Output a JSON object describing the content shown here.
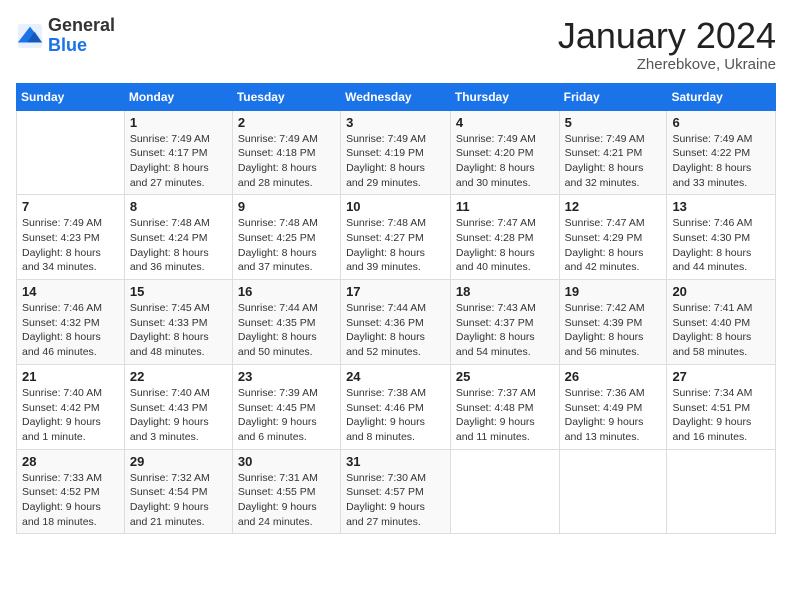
{
  "logo": {
    "general": "General",
    "blue": "Blue"
  },
  "title": "January 2024",
  "location": "Zherebkove, Ukraine",
  "days_of_week": [
    "Sunday",
    "Monday",
    "Tuesday",
    "Wednesday",
    "Thursday",
    "Friday",
    "Saturday"
  ],
  "weeks": [
    [
      {
        "day": "",
        "info": ""
      },
      {
        "day": "1",
        "info": "Sunrise: 7:49 AM\nSunset: 4:17 PM\nDaylight: 8 hours\nand 27 minutes."
      },
      {
        "day": "2",
        "info": "Sunrise: 7:49 AM\nSunset: 4:18 PM\nDaylight: 8 hours\nand 28 minutes."
      },
      {
        "day": "3",
        "info": "Sunrise: 7:49 AM\nSunset: 4:19 PM\nDaylight: 8 hours\nand 29 minutes."
      },
      {
        "day": "4",
        "info": "Sunrise: 7:49 AM\nSunset: 4:20 PM\nDaylight: 8 hours\nand 30 minutes."
      },
      {
        "day": "5",
        "info": "Sunrise: 7:49 AM\nSunset: 4:21 PM\nDaylight: 8 hours\nand 32 minutes."
      },
      {
        "day": "6",
        "info": "Sunrise: 7:49 AM\nSunset: 4:22 PM\nDaylight: 8 hours\nand 33 minutes."
      }
    ],
    [
      {
        "day": "7",
        "info": "Sunrise: 7:49 AM\nSunset: 4:23 PM\nDaylight: 8 hours\nand 34 minutes."
      },
      {
        "day": "8",
        "info": "Sunrise: 7:48 AM\nSunset: 4:24 PM\nDaylight: 8 hours\nand 36 minutes."
      },
      {
        "day": "9",
        "info": "Sunrise: 7:48 AM\nSunset: 4:25 PM\nDaylight: 8 hours\nand 37 minutes."
      },
      {
        "day": "10",
        "info": "Sunrise: 7:48 AM\nSunset: 4:27 PM\nDaylight: 8 hours\nand 39 minutes."
      },
      {
        "day": "11",
        "info": "Sunrise: 7:47 AM\nSunset: 4:28 PM\nDaylight: 8 hours\nand 40 minutes."
      },
      {
        "day": "12",
        "info": "Sunrise: 7:47 AM\nSunset: 4:29 PM\nDaylight: 8 hours\nand 42 minutes."
      },
      {
        "day": "13",
        "info": "Sunrise: 7:46 AM\nSunset: 4:30 PM\nDaylight: 8 hours\nand 44 minutes."
      }
    ],
    [
      {
        "day": "14",
        "info": "Sunrise: 7:46 AM\nSunset: 4:32 PM\nDaylight: 8 hours\nand 46 minutes."
      },
      {
        "day": "15",
        "info": "Sunrise: 7:45 AM\nSunset: 4:33 PM\nDaylight: 8 hours\nand 48 minutes."
      },
      {
        "day": "16",
        "info": "Sunrise: 7:44 AM\nSunset: 4:35 PM\nDaylight: 8 hours\nand 50 minutes."
      },
      {
        "day": "17",
        "info": "Sunrise: 7:44 AM\nSunset: 4:36 PM\nDaylight: 8 hours\nand 52 minutes."
      },
      {
        "day": "18",
        "info": "Sunrise: 7:43 AM\nSunset: 4:37 PM\nDaylight: 8 hours\nand 54 minutes."
      },
      {
        "day": "19",
        "info": "Sunrise: 7:42 AM\nSunset: 4:39 PM\nDaylight: 8 hours\nand 56 minutes."
      },
      {
        "day": "20",
        "info": "Sunrise: 7:41 AM\nSunset: 4:40 PM\nDaylight: 8 hours\nand 58 minutes."
      }
    ],
    [
      {
        "day": "21",
        "info": "Sunrise: 7:40 AM\nSunset: 4:42 PM\nDaylight: 9 hours\nand 1 minute."
      },
      {
        "day": "22",
        "info": "Sunrise: 7:40 AM\nSunset: 4:43 PM\nDaylight: 9 hours\nand 3 minutes."
      },
      {
        "day": "23",
        "info": "Sunrise: 7:39 AM\nSunset: 4:45 PM\nDaylight: 9 hours\nand 6 minutes."
      },
      {
        "day": "24",
        "info": "Sunrise: 7:38 AM\nSunset: 4:46 PM\nDaylight: 9 hours\nand 8 minutes."
      },
      {
        "day": "25",
        "info": "Sunrise: 7:37 AM\nSunset: 4:48 PM\nDaylight: 9 hours\nand 11 minutes."
      },
      {
        "day": "26",
        "info": "Sunrise: 7:36 AM\nSunset: 4:49 PM\nDaylight: 9 hours\nand 13 minutes."
      },
      {
        "day": "27",
        "info": "Sunrise: 7:34 AM\nSunset: 4:51 PM\nDaylight: 9 hours\nand 16 minutes."
      }
    ],
    [
      {
        "day": "28",
        "info": "Sunrise: 7:33 AM\nSunset: 4:52 PM\nDaylight: 9 hours\nand 18 minutes."
      },
      {
        "day": "29",
        "info": "Sunrise: 7:32 AM\nSunset: 4:54 PM\nDaylight: 9 hours\nand 21 minutes."
      },
      {
        "day": "30",
        "info": "Sunrise: 7:31 AM\nSunset: 4:55 PM\nDaylight: 9 hours\nand 24 minutes."
      },
      {
        "day": "31",
        "info": "Sunrise: 7:30 AM\nSunset: 4:57 PM\nDaylight: 9 hours\nand 27 minutes."
      },
      {
        "day": "",
        "info": ""
      },
      {
        "day": "",
        "info": ""
      },
      {
        "day": "",
        "info": ""
      }
    ]
  ]
}
